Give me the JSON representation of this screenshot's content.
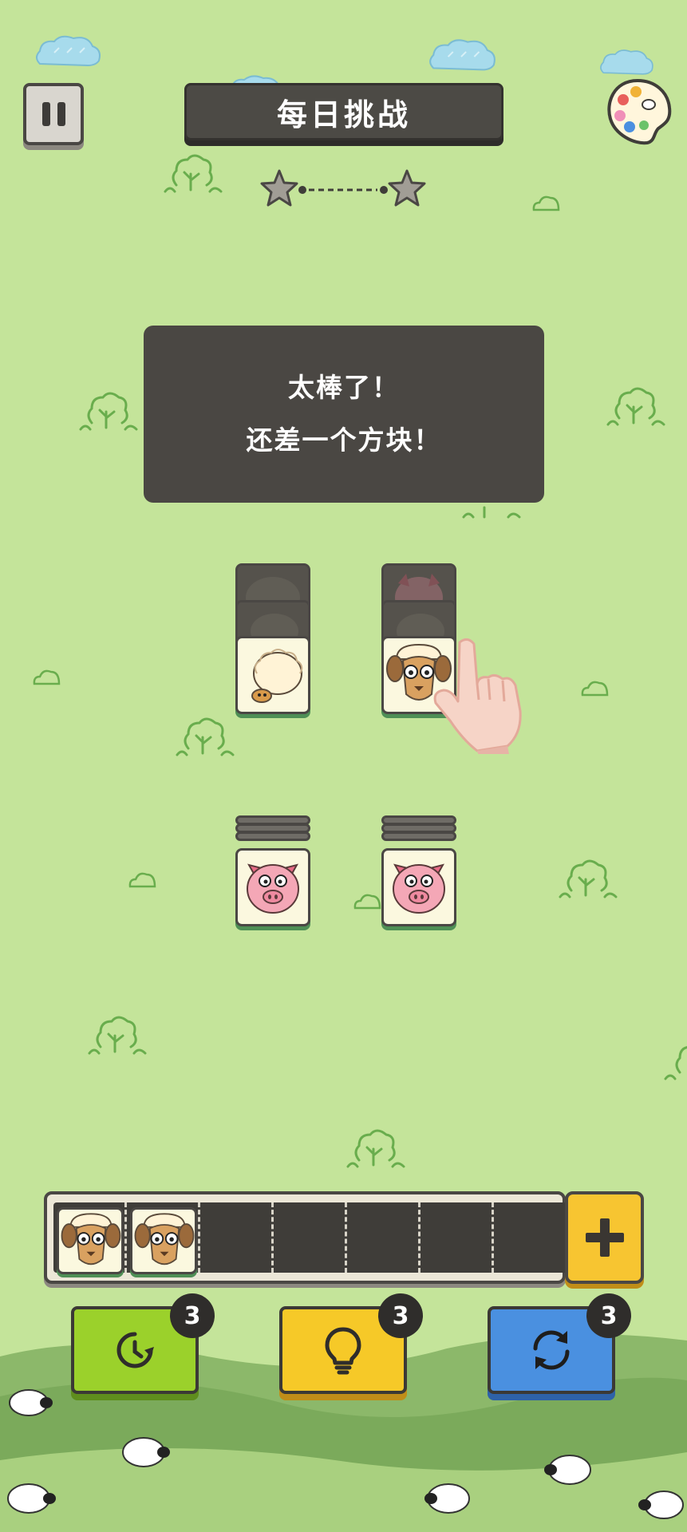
{
  "header": {
    "title": "每日挑战",
    "stars_total": 2
  },
  "toast": {
    "line1": "太棒了！",
    "line2": "还差一个方块！"
  },
  "board": {
    "tile_types": [
      "sheep-white",
      "sheep-brown",
      "pig"
    ],
    "visible_tiles": [
      {
        "type": "sheep-white",
        "covered_below": 2
      },
      {
        "type": "sheep-brown",
        "covered_below": 2
      },
      {
        "type": "pig",
        "covered_below": 3
      },
      {
        "type": "pig",
        "covered_below": 3
      }
    ]
  },
  "tray": {
    "capacity": 7,
    "filled": [
      "sheep-brown",
      "sheep-brown"
    ]
  },
  "tools": [
    {
      "name": "undo",
      "icon": "clock-undo-icon",
      "count": "3",
      "color": "#9bd12b"
    },
    {
      "name": "hint",
      "icon": "lightbulb-icon",
      "count": "3",
      "color": "#f6c928"
    },
    {
      "name": "shuffle",
      "icon": "refresh-icon",
      "count": "3",
      "color": "#4a90e0"
    }
  ],
  "colors": {
    "background": "#c4e49a",
    "banner": "#4c4a45",
    "tile_face": "#fbf8df",
    "tile_base": "#4f8f56"
  }
}
